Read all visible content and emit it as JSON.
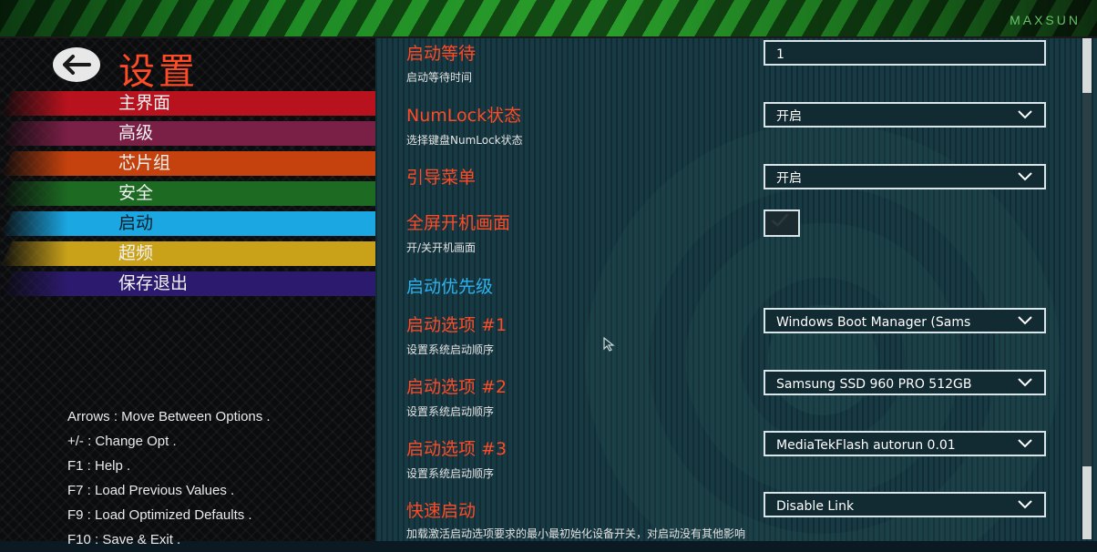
{
  "header": {
    "logo": "MAXSUN"
  },
  "sidebar": {
    "title": "设置",
    "items": [
      {
        "label": "主界面",
        "color": "#b8121e"
      },
      {
        "label": "高级",
        "color": "#7a1f46"
      },
      {
        "label": "芯片组",
        "color": "#c5420e"
      },
      {
        "label": "安全",
        "color": "#1d6a22"
      },
      {
        "label": "启动",
        "color": "#1aa7e2"
      },
      {
        "label": "超频",
        "color": "#c9a21a"
      },
      {
        "label": "保存退出",
        "color": "#2c1a6e"
      }
    ],
    "active_index": 4,
    "help": [
      "Arrows : Move Between Options .",
      "+/- : Change Opt .",
      "F1 : Help .",
      "F7 : Load Previous Values .",
      "F9 : Load Optimized Defaults .",
      "F10 : Save & Exit ."
    ]
  },
  "main": {
    "options": [
      {
        "label": "启动等待",
        "desc": "启动等待时间",
        "value": "1"
      },
      {
        "label": "NumLock状态",
        "desc": "选择键盘NumLock状态",
        "value": "开启"
      },
      {
        "label": "引导菜单",
        "desc": "",
        "value": "开启"
      },
      {
        "label": "全屏开机画面",
        "desc": "开/关开机画面",
        "checked": true
      }
    ],
    "section_title": "启动优先级",
    "boot": [
      {
        "label": "启动选项 #1",
        "desc": "设置系统启动顺序",
        "value": "Windows Boot Manager (Sams"
      },
      {
        "label": "启动选项 #2",
        "desc": "设置系统启动顺序",
        "value": "Samsung SSD 960 PRO 512GB"
      },
      {
        "label": "启动选项 #3",
        "desc": "设置系统启动顺序",
        "value": "MediaTekFlash autorun 0.01"
      }
    ],
    "fast_boot": {
      "label": "快速启动",
      "desc": "加载激活启动选项要求的最小最初始化设备开关，对启动没有其他影响",
      "value": "Disable Link"
    }
  }
}
